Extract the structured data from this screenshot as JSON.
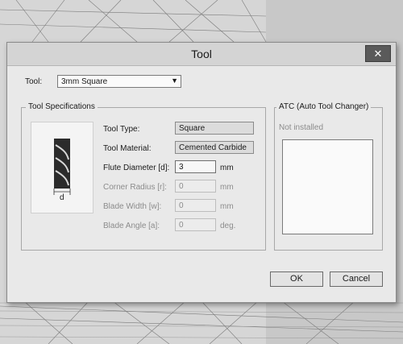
{
  "dialog": {
    "title": "Tool",
    "close_glyph": "✕"
  },
  "tool_select": {
    "label": "Tool:",
    "value": "3mm Square"
  },
  "specs": {
    "group_title": "Tool Specifications",
    "diagram_label": "d",
    "rows": [
      {
        "label": "Tool Type:",
        "value": "Square",
        "unit": ""
      },
      {
        "label": "Tool Material:",
        "value": "Cemented Carbide",
        "unit": ""
      },
      {
        "label": "Flute Diameter [d]:",
        "value": "3",
        "unit": "mm"
      },
      {
        "label": "Corner Radius [r]:",
        "value": "0",
        "unit": "mm"
      },
      {
        "label": "Blade Width [w]:",
        "value": "0",
        "unit": "mm"
      },
      {
        "label": "Blade Angle [a]:",
        "value": "0",
        "unit": "deg."
      }
    ]
  },
  "atc": {
    "group_title": "ATC (Auto Tool Changer)",
    "status": "Not installed"
  },
  "buttons": {
    "ok": "OK",
    "cancel": "Cancel"
  }
}
